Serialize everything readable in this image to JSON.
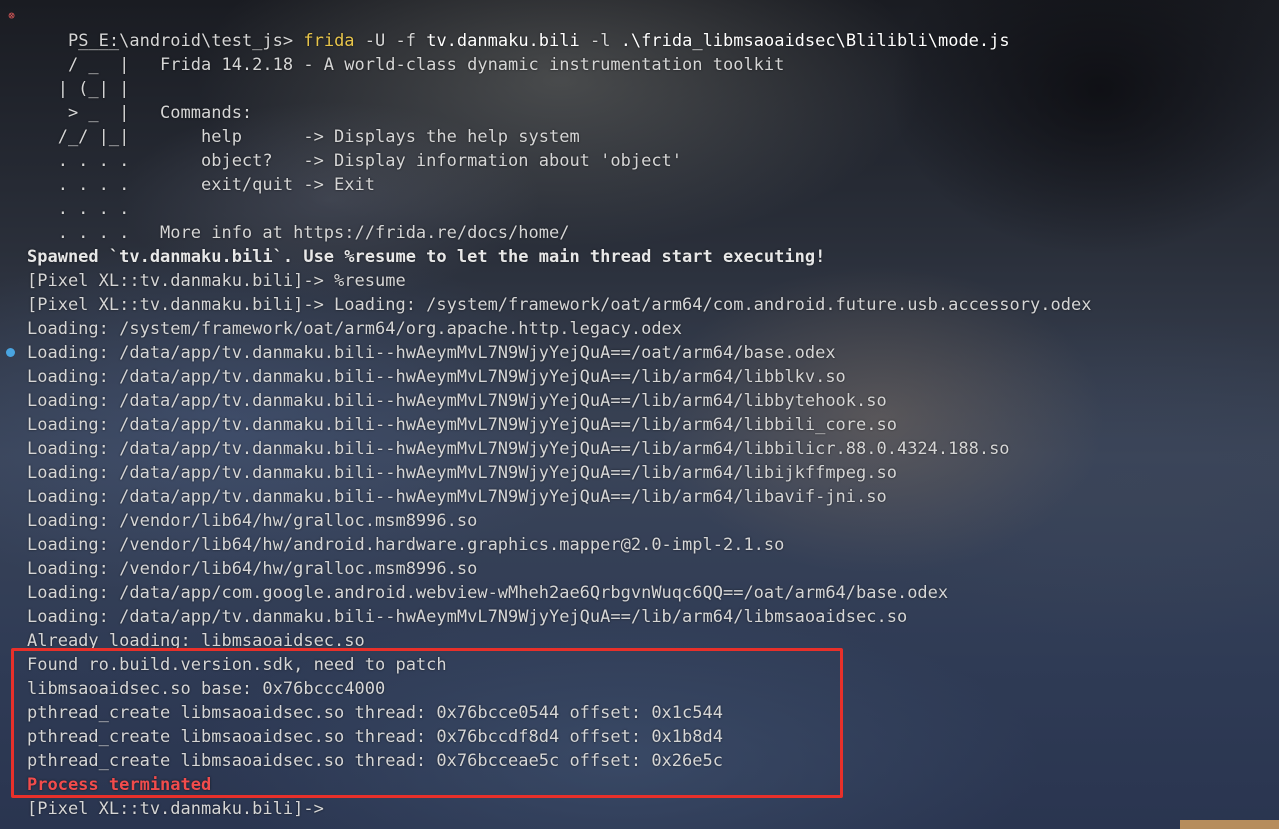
{
  "prompt": {
    "prefix": "PS E:\\android\\test_js> ",
    "command_name": "frida",
    "args_part1": " -U -f ",
    "package": "tv.danmaku.bili",
    "args_part2": " -l ",
    "script_path": ".\\frida_libmsaoaidsec\\Blilibli\\mode.js"
  },
  "banner": [
    "     ____",
    "    / _  |   Frida 14.2.18 - A world-class dynamic instrumentation toolkit",
    "   | (_| |",
    "    > _  |   Commands:",
    "   /_/ |_|       help      -> Displays the help system",
    "   . . . .       object?   -> Display information about 'object'",
    "   . . . .       exit/quit -> Exit",
    "   . . . .",
    "   . . . .   More info at https://frida.re/docs/home/"
  ],
  "spawned_line": "Spawned `tv.danmaku.bili`. Use %resume to let the main thread start executing!",
  "log_lines": [
    "[Pixel XL::tv.danmaku.bili]-> %resume",
    "[Pixel XL::tv.danmaku.bili]-> Loading: /system/framework/oat/arm64/com.android.future.usb.accessory.odex",
    "Loading: /system/framework/oat/arm64/org.apache.http.legacy.odex",
    "Loading: /data/app/tv.danmaku.bili--hwAeymMvL7N9WjyYejQuA==/oat/arm64/base.odex",
    "Loading: /data/app/tv.danmaku.bili--hwAeymMvL7N9WjyYejQuA==/lib/arm64/libblkv.so",
    "Loading: /data/app/tv.danmaku.bili--hwAeymMvL7N9WjyYejQuA==/lib/arm64/libbytehook.so",
    "Loading: /data/app/tv.danmaku.bili--hwAeymMvL7N9WjyYejQuA==/lib/arm64/libbili_core.so",
    "Loading: /data/app/tv.danmaku.bili--hwAeymMvL7N9WjyYejQuA==/lib/arm64/libbilicr.88.0.4324.188.so",
    "Loading: /data/app/tv.danmaku.bili--hwAeymMvL7N9WjyYejQuA==/lib/arm64/libijkffmpeg.so",
    "Loading: /data/app/tv.danmaku.bili--hwAeymMvL7N9WjyYejQuA==/lib/arm64/libavif-jni.so",
    "Loading: /vendor/lib64/hw/gralloc.msm8996.so",
    "Loading: /vendor/lib64/hw/android.hardware.graphics.mapper@2.0-impl-2.1.so",
    "Loading: /vendor/lib64/hw/gralloc.msm8996.so",
    "Loading: /data/app/com.google.android.webview-wMheh2ae6QrbgvnWuqc6QQ==/oat/arm64/base.odex",
    "Loading: /data/app/tv.danmaku.bili--hwAeymMvL7N9WjyYejQuA==/lib/arm64/libmsaoaidsec.so",
    "Already loading: libmsaoaidsec.so"
  ],
  "highlighted_lines": [
    "Found ro.build.version.sdk, need to patch",
    "libmsaoaidsec.so base: 0x76bccc4000",
    "pthread_create libmsaoaidsec.so thread: 0x76bcce0544 offset: 0x1c544",
    "pthread_create libmsaoaidsec.so thread: 0x76bccdf8d4 offset: 0x1b8d4",
    "pthread_create libmsaoaidsec.so thread: 0x76bcceae5c offset: 0x26e5c"
  ],
  "terminated_line": "Process terminated",
  "final_prompt": "[Pixel XL::tv.danmaku.bili]->",
  "icons": {
    "error_icon": "⊗",
    "error_icon_name": "error-circle-icon"
  },
  "colors": {
    "frida_keyword": "#e8c54a",
    "terminated": "#f24c4c",
    "highlight_border": "#e8302a",
    "text": "#d6d6d6"
  }
}
